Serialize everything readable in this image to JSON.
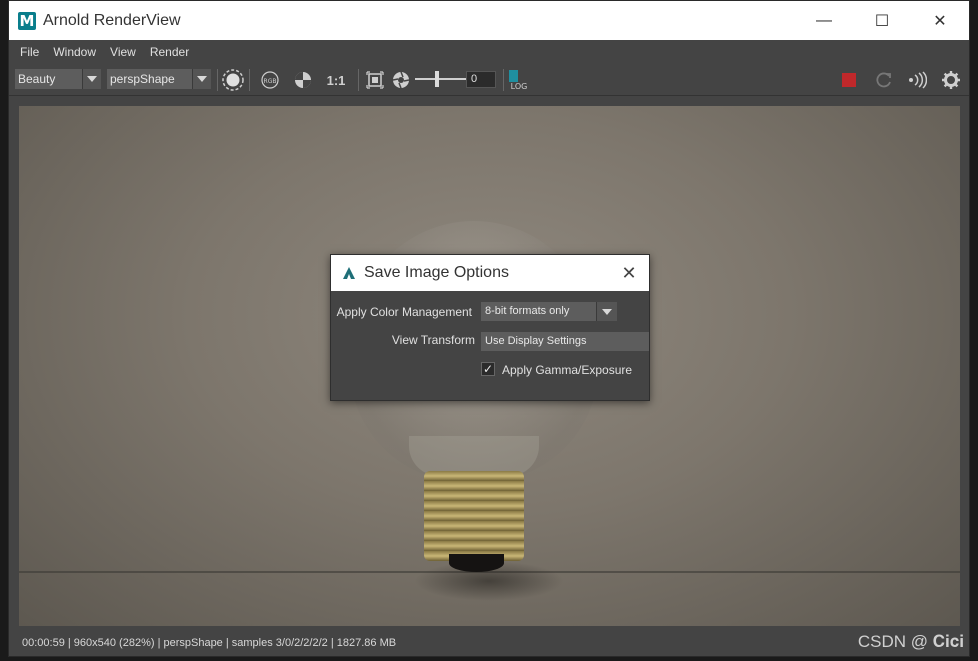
{
  "window": {
    "title": "Arnold RenderView",
    "app_icon": "M",
    "controls": {
      "minimize": "—",
      "maximize": "☐",
      "close": "✕"
    }
  },
  "menubar": {
    "items": [
      "File",
      "Window",
      "View",
      "Render"
    ]
  },
  "toolbar": {
    "aov_value": "Beauty",
    "camera_value": "perspShape",
    "ratio_label": "1:1",
    "rgb_label": "RGB",
    "exposure_value": "0",
    "log_label": "LOG",
    "icons": [
      "circle-snapshot-icon",
      "rgb-icon",
      "checker-icon",
      "region-icon",
      "aperture-icon",
      "log-icon",
      "stop-icon",
      "refresh-icon",
      "broadcast-icon",
      "gear-icon"
    ],
    "stop_color": "#c0282b"
  },
  "dialog": {
    "title": "Save Image Options",
    "color_mgmt_label": "Apply Color Management",
    "color_mgmt_value": "8-bit formats only",
    "view_transform_label": "View Transform",
    "view_transform_value": "Use Display Settings",
    "gamma_label": "Apply Gamma/Exposure",
    "gamma_checked": true
  },
  "status": {
    "text": "00:00:59 | 960x540 (282%) | perspShape  | samples 3/0/2/2/2/2 | 1827.86 MB"
  },
  "watermark": "CSDN @ 𝐂𝐢𝐜𝐢"
}
